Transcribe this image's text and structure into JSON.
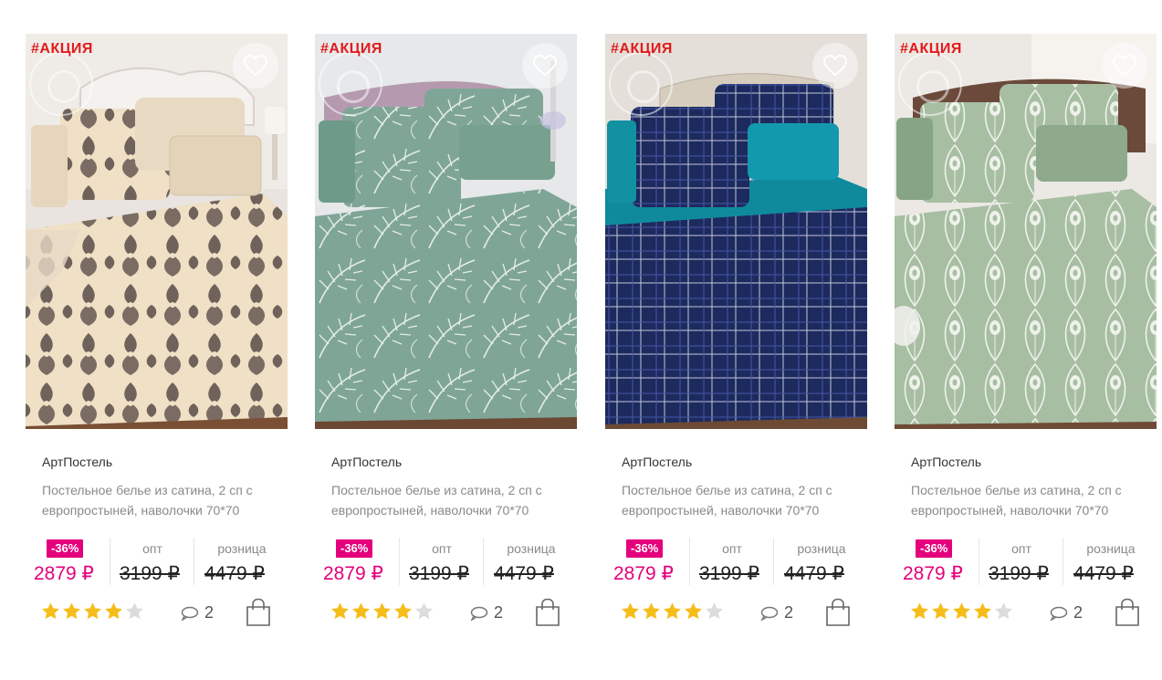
{
  "colors": {
    "promo": "#e21b1b",
    "discount_badge": "#e4007c",
    "sale_price": "#e4007c",
    "star_filled": "#f6bd1a",
    "star_empty": "#dcdcdc"
  },
  "products": [
    {
      "promo_tag": "#АКЦИЯ",
      "image_theme": "beige-damask",
      "brand": "АртПостель",
      "description": "Постельное белье из сатина, 2 сп с европростыней, наволочки 70*70",
      "discount": "-36%",
      "sale_price": "2879 ₽",
      "opt_label": "опт",
      "opt_price": "3199 ₽",
      "retail_label": "розница",
      "retail_price": "4479 ₽",
      "rating": 4,
      "rating_max": 5,
      "comments": "2",
      "icons": {
        "favorite": "heart-icon",
        "comments": "speech-bubble-icon",
        "cart": "shopping-bag-icon"
      }
    },
    {
      "promo_tag": "#АКЦИЯ",
      "image_theme": "green-tropical",
      "brand": "АртПостель",
      "description": "Постельное белье из сатина, 2 сп с европростыней, наволочки 70*70",
      "discount": "-36%",
      "sale_price": "2879 ₽",
      "opt_label": "опт",
      "opt_price": "3199 ₽",
      "retail_label": "розница",
      "retail_price": "4479 ₽",
      "rating": 4,
      "rating_max": 5,
      "comments": "2",
      "icons": {
        "favorite": "heart-icon",
        "comments": "speech-bubble-icon",
        "cart": "shopping-bag-icon"
      }
    },
    {
      "promo_tag": "#АКЦИЯ",
      "image_theme": "navy-plaid",
      "brand": "АртПостель",
      "description": "Постельное белье из сатина, 2 сп с европростыней, наволочки 70*70",
      "discount": "-36%",
      "sale_price": "2879 ₽",
      "opt_label": "опт",
      "opt_price": "3199 ₽",
      "retail_label": "розница",
      "retail_price": "4479 ₽",
      "rating": 4,
      "rating_max": 5,
      "comments": "2",
      "icons": {
        "favorite": "heart-icon",
        "comments": "speech-bubble-icon",
        "cart": "shopping-bag-icon"
      }
    },
    {
      "promo_tag": "#АКЦИЯ",
      "image_theme": "sage-peacock-feather",
      "brand": "АртПостель",
      "description": "Постельное белье из сатина, 2 сп с европростыней, наволочки 70*70",
      "discount": "-36%",
      "sale_price": "2879 ₽",
      "opt_label": "опт",
      "opt_price": "3199 ₽",
      "retail_label": "розница",
      "retail_price": "4479 ₽",
      "rating": 4,
      "rating_max": 5,
      "comments": "2",
      "icons": {
        "favorite": "heart-icon",
        "comments": "speech-bubble-icon",
        "cart": "shopping-bag-icon"
      }
    }
  ]
}
